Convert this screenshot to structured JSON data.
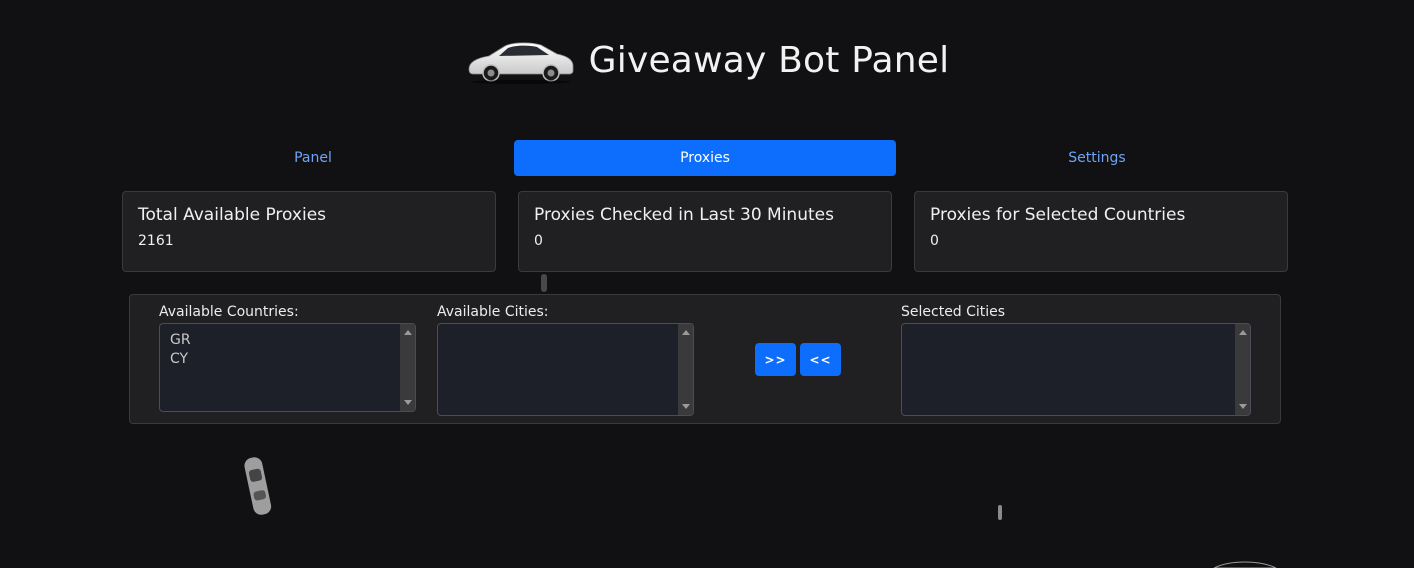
{
  "header": {
    "title": "Giveaway Bot Panel",
    "logo_icon": "car-icon"
  },
  "tabs": [
    {
      "label": "Panel",
      "active": false
    },
    {
      "label": "Proxies",
      "active": true
    },
    {
      "label": "Settings",
      "active": false
    }
  ],
  "stats": [
    {
      "title": "Total Available Proxies",
      "value": "2161"
    },
    {
      "title": "Proxies Checked in Last 30 Minutes",
      "value": "0"
    },
    {
      "title": "Proxies for Selected Countries",
      "value": "0"
    }
  ],
  "selection": {
    "countries_label": "Available Countries:",
    "countries": [
      "GR",
      "CY"
    ],
    "cities_label": "Available Cities:",
    "cities": [],
    "selected_label": "Selected Cities",
    "selected": [],
    "add_button": ">>",
    "remove_button": "<<"
  },
  "colors": {
    "background": "#111113",
    "card": "#202022",
    "accent": "#0d6efd",
    "tab_link": "#6ea4f7"
  }
}
